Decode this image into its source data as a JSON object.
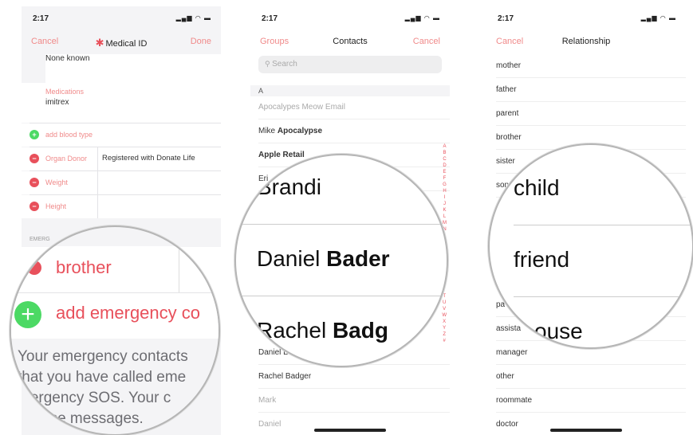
{
  "panel1": {
    "time": "2:17",
    "nav": {
      "left": "Cancel",
      "title": "Medical ID",
      "right": "Done"
    },
    "allergies_value": "None known",
    "medications_label": "Medications",
    "medications_value": "imitrex",
    "add_blood_type": "add blood type",
    "organ_donor_label": "Organ Donor",
    "organ_donor_value": "Registered with Donate Life",
    "weight_label": "Weight",
    "height_label": "Height",
    "section_label": "EMERG",
    "magnified": {
      "relationship": "brother",
      "add_contact": "add emergency co",
      "footer_lines": [
        "Your emergency contacts",
        "that you have called eme",
        "mergency SOS. Your c",
        "ese messages."
      ]
    }
  },
  "panel2": {
    "time": "2:17",
    "nav": {
      "left": "Groups",
      "title": "Contacts",
      "right": "Cancel"
    },
    "search_placeholder": "Search",
    "section": "A",
    "contacts_top": [
      {
        "first": "Apocalypes Meow Email",
        "last": ""
      },
      {
        "first": "Mike ",
        "last": "Apocalypse"
      },
      {
        "first": "",
        "last": "Apple Retail"
      },
      {
        "first": "Eri",
        "last": ""
      }
    ],
    "contacts_bottom": [
      {
        "first": "Daniel B",
        "last": ""
      },
      {
        "first": "Rachel Badger",
        "last": ""
      },
      {
        "first": "Mark",
        "last": ""
      },
      {
        "first": "Daniel",
        "last": ""
      }
    ],
    "index_top": [
      "A",
      "B",
      "C",
      "D",
      "E",
      "F",
      "G",
      "H",
      "I",
      "J",
      "K",
      "L",
      "M",
      "N"
    ],
    "index_bottom": [
      "T",
      "U",
      "V",
      "W",
      "X",
      "Y",
      "Z",
      "#"
    ],
    "magnified": {
      "row1": "Brandi",
      "row2_first": "Daniel ",
      "row2_last": "Bader",
      "row3_first": "Rachel ",
      "row3_last": "Badg"
    }
  },
  "panel3": {
    "time": "2:17",
    "nav": {
      "left": "Cancel",
      "title": "Relationship"
    },
    "items_top": [
      "mother",
      "father",
      "parent",
      "brother",
      "sister",
      "son"
    ],
    "items_bottom": [
      "pa",
      "assista",
      "manager",
      "other",
      "roommate",
      "doctor"
    ],
    "magnified": {
      "row1": "child",
      "row2": "friend",
      "row3": "ouse"
    }
  },
  "colors": {
    "accent_red": "#e8505b",
    "accent_pink": "#f08a8a",
    "add_green": "#4cd964"
  }
}
